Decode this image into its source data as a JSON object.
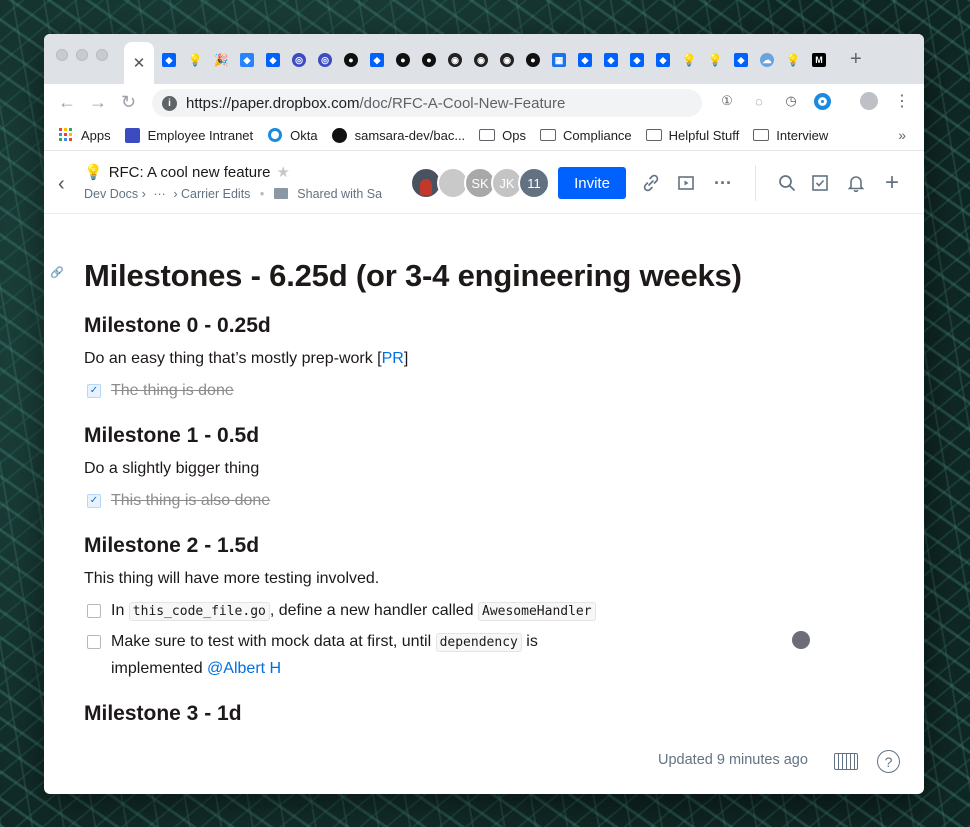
{
  "browser": {
    "close_tab": "✕",
    "new_tab": "+",
    "url_host": "https://paper.dropbox.com",
    "url_path": "/doc/RFC-A-Cool-New-Feature"
  },
  "bookmarks": [
    "Apps",
    "Employee Intranet",
    "Okta",
    "samsara-dev/bac...",
    "Ops",
    "Compliance",
    "Helpful Stuff",
    "Interview"
  ],
  "header": {
    "title": "RFC: A cool new feature",
    "breadcrumb_1": "Dev Docs",
    "breadcrumb_sep": "›",
    "breadcrumb_ellipsis": "···",
    "breadcrumb_2": "Carrier Edits",
    "shared": "Shared with Sa",
    "avatar_initials": [
      "SK",
      "JK"
    ],
    "avatar_count": "11",
    "invite_label": "Invite"
  },
  "doc": {
    "heading": "Milestones - 6.25d (or 3-4 engineering weeks)",
    "m0": {
      "title": "Milestone 0 - 0.25d",
      "text": "Do an easy thing that’s mostly prep-work [",
      "link": "PR",
      "text_end": "]",
      "task": "The thing is done"
    },
    "m1": {
      "title": "Milestone 1 - 0.5d",
      "text": "Do a slightly bigger thing",
      "task": "This thing is also done"
    },
    "m2": {
      "title": "Milestone 2 - 1.5d",
      "text": "This thing will have more testing involved.",
      "task1_a": "In ",
      "task1_code1": "this_code_file.go",
      "task1_b": ", define a new handler called ",
      "task1_code2": "AwesomeHandler",
      "task2_a": "Make sure to test with mock data at first, until ",
      "task2_code": "dependency",
      "task2_b": " is implemented ",
      "task2_mention": "@Albert H"
    },
    "m3": {
      "title": "Milestone 3 - 1d"
    }
  },
  "footer": {
    "updated": "Updated 9 minutes ago",
    "help": "?"
  }
}
